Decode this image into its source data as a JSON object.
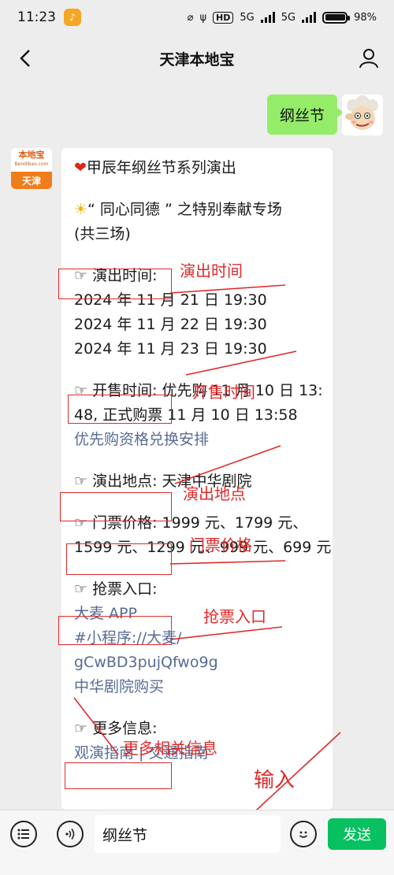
{
  "status_bar": {
    "time": "11:23",
    "battery": "98%",
    "hd": "HD",
    "network_1": "5G",
    "network_2": "5G"
  },
  "nav": {
    "title": "天津本地宝"
  },
  "outgoing_message": {
    "text": "纲丝节"
  },
  "bot": {
    "logo_text": "本地宝",
    "logo_sub": "Bendibao.com",
    "logo_city": "天津"
  },
  "incoming_message": {
    "line1": "甲辰年纲丝节系列演出",
    "line2": "“ 同心同德 ” 之特别奉献专场",
    "line3": "(共三场)",
    "perf_time_label": "☞ 演出时间:",
    "perf_time_1": "2024 年 11 月 21 日 19:30",
    "perf_time_2": "2024 年 11 月 22 日 19:30",
    "perf_time_3": "2024 年 11 月 23 日 19:30",
    "sale_time_line1": "☞ 开售时间: 优先购 11 月 10 日 13:",
    "sale_time_line2": "48, 正式购票 11 月 10 日 13:58",
    "sale_link": "优先购资格兑换安排",
    "venue_line": "☞ 演出地点: 天津中华剧院",
    "price_line1": "☞ 门票价格: 1999 元、1799 元、",
    "price_line2": "1599 元、1299 元、999 元、699 元",
    "ticket_label": "☞ 抢票入口:",
    "ticket_link_1": "大麦 APP",
    "ticket_link_2": "#小程序://大麦/",
    "ticket_link_3": "gCwBD3pujQfwo9g",
    "ticket_link_4": "中华剧院购买",
    "more_label": "☞ 更多信息:",
    "more_links": "观演指南 | 交通指南"
  },
  "annotations": {
    "perf_time": "演出时间",
    "sale_time": "开售时间",
    "venue": "演出地点",
    "price": "门票价格",
    "ticket": "抢票入口",
    "more": "更多相关信息",
    "input": "输入"
  },
  "input_bar": {
    "value": "纲丝节",
    "send_label": "发送"
  },
  "colors": {
    "background": "#ededed",
    "bubble_out": "#95ec69",
    "link": "#576b95",
    "annotation": "#e02a2a",
    "send": "#07c160"
  }
}
